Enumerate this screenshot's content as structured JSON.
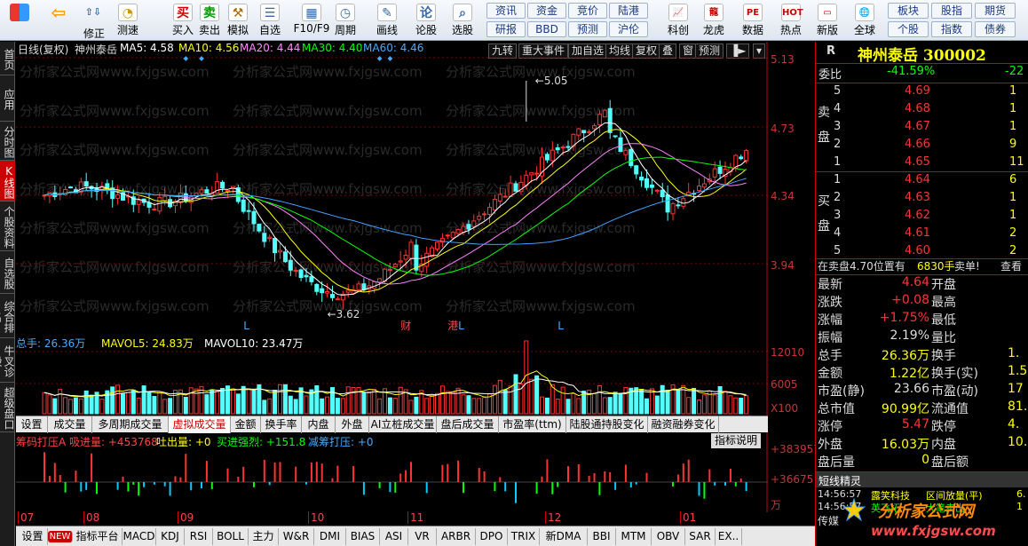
{
  "toolbar": {
    "left": [
      "修正",
      "测速",
      "买入",
      "卖出",
      "模拟",
      "自选",
      "F10/F9",
      "周期",
      "画线",
      "论股",
      "选股"
    ],
    "grid": [
      [
        "资讯",
        "资金",
        "竞价",
        "陆港"
      ],
      [
        "研报",
        "BBD",
        "预测",
        "沪伦"
      ]
    ],
    "right": [
      "科创",
      "龙虎",
      "数据",
      "热点",
      "新版",
      "全球"
    ],
    "grid2": [
      [
        "板块",
        "股指",
        "期货"
      ],
      [
        "个股",
        "指数",
        "债券"
      ]
    ],
    "sidebar": [
      "首页",
      "应用",
      "分时图",
      "K线图",
      "个股资料",
      "自选股",
      "综合排名",
      "牛叉诊股",
      "超级盘口"
    ]
  },
  "header": {
    "mode": "日线(复权)",
    "name": "神州泰岳",
    "ma5": "MA5: 4.58",
    "ma10": "MA10: 4.56",
    "ma20": "MA20: 4.44",
    "ma30": "MA30: 4.40",
    "ma60": "MA60: 4.46"
  },
  "chart_buttons": [
    "九转",
    "重大事件",
    "加自选",
    "均线",
    "复权",
    "叠",
    "窗",
    "预测"
  ],
  "price_axis": [
    "5.13",
    "4.73",
    "4.34",
    "3.94"
  ],
  "annotations": {
    "high": "5.05",
    "low": "3.62",
    "markers": [
      "L",
      "L",
      "L"
    ],
    "events": [
      "财",
      "港"
    ]
  },
  "volume": {
    "title": "总手: 26.36万",
    "mavol5": "MAVOL5: 24.83万",
    "mavol10": "MAVOL10: 23.47万",
    "axis": [
      "12010",
      "6005",
      "X100"
    ]
  },
  "mid_tabs": [
    "设置",
    "成交量",
    "多周期成交量",
    "虚拟成交量",
    "金额",
    "换手率",
    "内盘",
    "外盘",
    "AI立桩成交量",
    "盘后成交量",
    "市盈率(ttm)",
    "陆股通持股变化",
    "融资融券变化"
  ],
  "indicator": {
    "title": "筹码打压A 吸进量: +453768",
    "s1": "吐出量: +0",
    "s2": "买进强烈: +151.8",
    "s3": "减筹打压: +0",
    "axis": [
      "+383957",
      "+36675",
      "万"
    ],
    "explain": "指标说明"
  },
  "months": [
    "07",
    "08",
    "09",
    "10",
    "11",
    "12",
    "01"
  ],
  "bottom_tabs": [
    "设置",
    "NEW",
    "指标平台",
    "MACD",
    "KDJ",
    "RSI",
    "BOLL",
    "主力",
    "W&R",
    "DMI",
    "BIAS",
    "ASI",
    "VR",
    "ARBR",
    "DPO",
    "TRIX",
    "新DMA",
    "BBI",
    "MTM",
    "OBV",
    "SAR",
    "EX.."
  ],
  "quote": {
    "label": "R",
    "name": "神州泰岳 300002",
    "weibi_label": "委比",
    "weibi": "-41.59%",
    "weicha": "-22",
    "sell": [
      [
        "5",
        "4.69",
        "1"
      ],
      [
        "4",
        "4.68",
        "1"
      ],
      [
        "3",
        "4.67",
        "1"
      ],
      [
        "2",
        "4.66",
        "9"
      ],
      [
        "1",
        "4.65",
        "11"
      ]
    ],
    "buy": [
      [
        "1",
        "4.64",
        "6"
      ],
      [
        "2",
        "4.63",
        "1"
      ],
      [
        "3",
        "4.62",
        "1"
      ],
      [
        "4",
        "4.61",
        "2"
      ],
      [
        "5",
        "4.60",
        "2"
      ]
    ],
    "sell_side": "卖盘",
    "buy_side": "买盘",
    "status": "在卖盘4.70位置有",
    "status_vol": "6830手",
    "status2": "卖单!",
    "status3": "查看",
    "stats": [
      [
        "最新",
        "4.64",
        "开盘",
        ""
      ],
      [
        "涨跌",
        "+0.08",
        "最高",
        ""
      ],
      [
        "涨幅",
        "+1.75%",
        "最低",
        ""
      ],
      [
        "振幅",
        "2.19%",
        "量比",
        ""
      ],
      [
        "总手",
        "26.36万",
        "换手",
        "1."
      ],
      [
        "金额",
        "1.22亿",
        "换手(实)",
        "1.5"
      ],
      [
        "市盈(静)",
        "23.66",
        "市盈(动)",
        "17"
      ],
      [
        "总市值",
        "90.99亿",
        "流通值",
        "81.8"
      ],
      [
        "涨停",
        "5.47",
        "跌停",
        "4."
      ],
      [
        "外盘",
        "16.03万",
        "内盘",
        "10.3"
      ],
      [
        "盘后量",
        "0",
        "盘后额",
        ""
      ]
    ],
    "short_title": "短线精灵",
    "short": [
      [
        "14:56:57",
        "露笑科技",
        "区间放量(平)",
        "6."
      ],
      [
        "14:56:57",
        "英飞拓",
        "大笔卖出",
        "1"
      ]
    ],
    "footer": "传媒",
    "logo": "分析家公式网",
    "url": "www.fxjgsw.com"
  },
  "watermark": "分析家公式网www.fxjgsw.com",
  "colors": {
    "up": "#ff3232",
    "down": "#54ffff",
    "ma5": "#ffffff",
    "ma10": "#ffff00",
    "ma20": "#ff80ff",
    "ma30": "#00ff00",
    "ma60": "#40a0ff"
  }
}
